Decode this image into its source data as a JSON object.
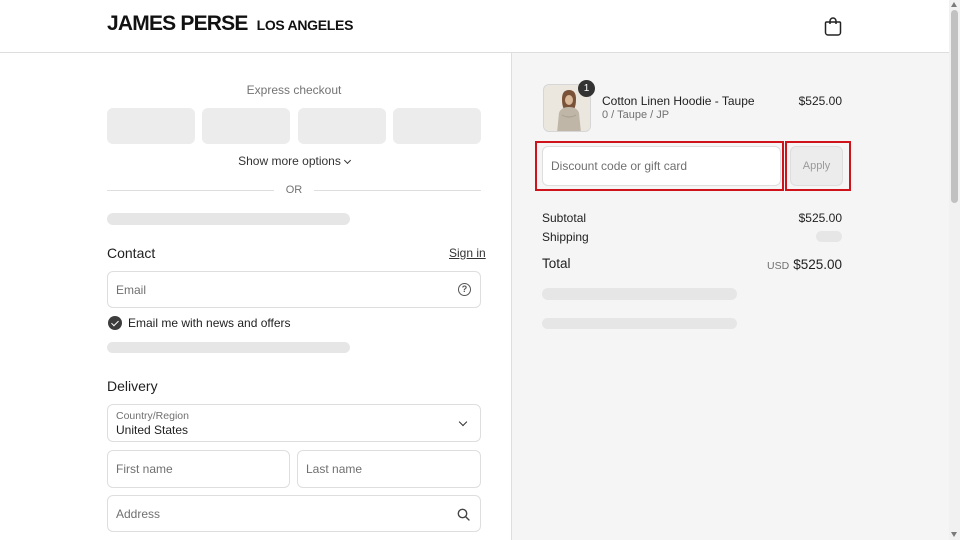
{
  "header": {
    "brand_main": "JAMES PERSE",
    "brand_sub": "LOS ANGELES",
    "cart_icon": "shopping-bag-icon"
  },
  "checkout": {
    "express_label": "Express checkout",
    "express_buttons": [
      "",
      "",
      "",
      ""
    ],
    "show_more_label": "Show more options",
    "or_label": "OR",
    "contact": {
      "title": "Contact",
      "sign_in_label": "Sign in",
      "email_placeholder": "Email",
      "email_value": "",
      "help_icon": "question-circle-icon",
      "newsletter_label": "Email me with news and offers",
      "newsletter_checked": true
    },
    "delivery": {
      "title": "Delivery",
      "country_label": "Country/Region",
      "country_value": "United States",
      "first_name_placeholder": "First name",
      "last_name_placeholder": "Last name",
      "address_placeholder": "Address",
      "address_icon": "search-icon"
    }
  },
  "summary": {
    "product": {
      "name": "Cotton Linen Hoodie - Taupe",
      "variant": "0 / Taupe / JP",
      "price": "$525.00",
      "quantity": "1"
    },
    "discount_placeholder": "Discount code or gift card",
    "apply_label": "Apply",
    "subtotal_label": "Subtotal",
    "subtotal_value": "$525.00",
    "shipping_label": "Shipping",
    "total_label": "Total",
    "total_currency": "USD",
    "total_value": "$525.00"
  },
  "colors": {
    "highlight": "#d0131a",
    "summary_bg": "#f5f5f5",
    "skeleton": "#e6e6e6"
  }
}
